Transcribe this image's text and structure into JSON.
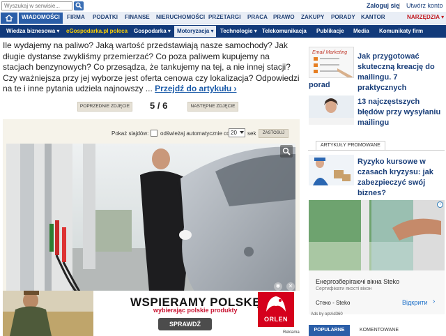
{
  "top": {
    "search_placeholder": "Wyszukaj w serwisie...",
    "login": "Zaloguj się",
    "separator": "|",
    "register": "Utwórz konto"
  },
  "mainnav": {
    "items": [
      "WIADOMOŚCI",
      "FIRMA",
      "PODATKI",
      "FINANSE",
      "NIERUCHOMOŚCI",
      "PRZETARGI",
      "PRACA",
      "PRAWO",
      "ZAKUPY",
      "PORADY",
      "KANTOR",
      "NARZĘDZIA ▾"
    ]
  },
  "subnav": {
    "items": [
      "Wiedza biznesowa ▾",
      "eGospodarka.pl poleca",
      "Gospodarka ▾",
      "Motoryzacja ▾",
      "Technologie ▾",
      "Telekomunikacja",
      "Publikacje",
      "Media",
      "Komunikaty firm"
    ]
  },
  "article": {
    "teaser": "Ile wydajemy na paliwo? Jaką wartość przedstawiają nasze samochody? Jak długie dystanse zwykliśmy przemierzać? Co poza paliwem kupujemy na stacjach benzynowych? Co przesądza, że tankujemy na tej, a nie innej stacji? Czy ważniejsza przy jej wyborze jest oferta cenowa czy lokalizacja? Odpowiedzi na te i inne pytania udziela najnowszy ... ",
    "more": "Przejdź do artykułu ›"
  },
  "pager": {
    "prev": "POPRZEDNIE ZDJĘCIE",
    "counter": "5 / 6",
    "next": "NASTĘPNE ZDJĘCIE"
  },
  "slideshow": {
    "label": "Pokaż slajdów:",
    "auto_label": "odświeżaj automatycznie co",
    "seconds_value": "20",
    "seconds_unit": "sek",
    "apply": "ZASTOSUJ"
  },
  "banner": {
    "title": "WSPIERAMY POLSKĘ",
    "subtitle": "wybierając polskie produkty",
    "cta": "SPRAWDŹ",
    "logo": "ORLEN",
    "ad_tag": "Reklama"
  },
  "sidebar": {
    "links": [
      {
        "text": "Jak przygotować skuteczną kreację do mailingu. 7 praktycznych",
        "text2": "porad"
      },
      {
        "text": "13 najczęstszych błędów przy wysyłaniu mailingu"
      },
      {
        "text": "Ryzyko kursowe w czasach kryzysu: jak zabezpieczyć swój biznes?"
      }
    ],
    "promo_tab": "ARTYKUŁY PROMOWANE",
    "thumb1_label": "Email Marketing"
  },
  "ad": {
    "title": "Енергозберігаючі вікна Steko",
    "subtitle": "Сертифікати якості вікон",
    "brand": "Стеко - Steko",
    "cta": "Відкрити",
    "cta_arrow": "›",
    "badge": "Ads by optAd360",
    "info": "i"
  },
  "tabs": {
    "popular": "POPULARNE",
    "comments": "KOMENTOWANE"
  }
}
